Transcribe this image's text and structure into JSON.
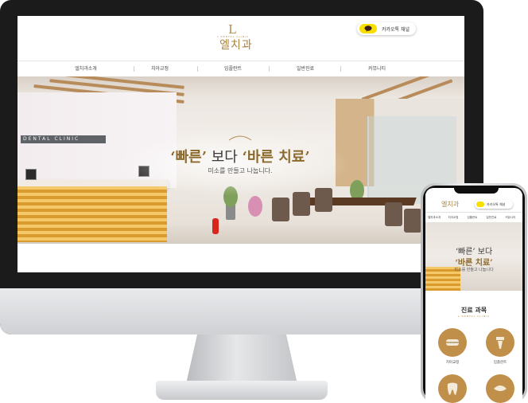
{
  "desktop": {
    "logo": {
      "mark": "L",
      "subtitle": "L DENTAL CLINIC",
      "text": "엘치과"
    },
    "kakao_button": {
      "label": "카카오톡 채널",
      "icon": "kakao-chat-icon"
    },
    "nav": {
      "items": [
        {
          "label": "엘치과소개"
        },
        {
          "label": "치아교정"
        },
        {
          "label": "임플란트"
        },
        {
          "label": "일반진료"
        },
        {
          "label": "커뮤니티"
        }
      ]
    },
    "hero": {
      "headline_part1": "‘빠른’",
      "headline_part2": "보다",
      "headline_part3": "‘바른 치료’",
      "subtext": "미소를 만들고 나눕니다.",
      "signage": "DENTAL CLINIC"
    }
  },
  "mobile": {
    "logo_text": "엘치과",
    "kakao_label": "카카오톡 채널",
    "nav": {
      "items": [
        {
          "label": "엘치과소개"
        },
        {
          "label": "치아교정"
        },
        {
          "label": "임플란트"
        },
        {
          "label": "일반진료"
        },
        {
          "label": "커뮤니티"
        }
      ]
    },
    "hero": {
      "headline_line1": "‘빠른’ 보다",
      "headline_line2": "‘바른 치료’",
      "subtext": "미소를 만들고 나눕니다"
    },
    "services": {
      "title": "진료 과목",
      "subtitle": "L DENTAL CLINIC",
      "items": [
        {
          "label": "치아교정",
          "icon": "braces-icon"
        },
        {
          "label": "임플란트",
          "icon": "implant-icon"
        },
        {
          "label": "",
          "icon": "tooth-icon"
        },
        {
          "label": "",
          "icon": "denture-icon"
        }
      ]
    }
  },
  "colors": {
    "gold": "#b38b4d",
    "kakao_yellow": "#f9df00",
    "service_circle": "#c0904b"
  }
}
